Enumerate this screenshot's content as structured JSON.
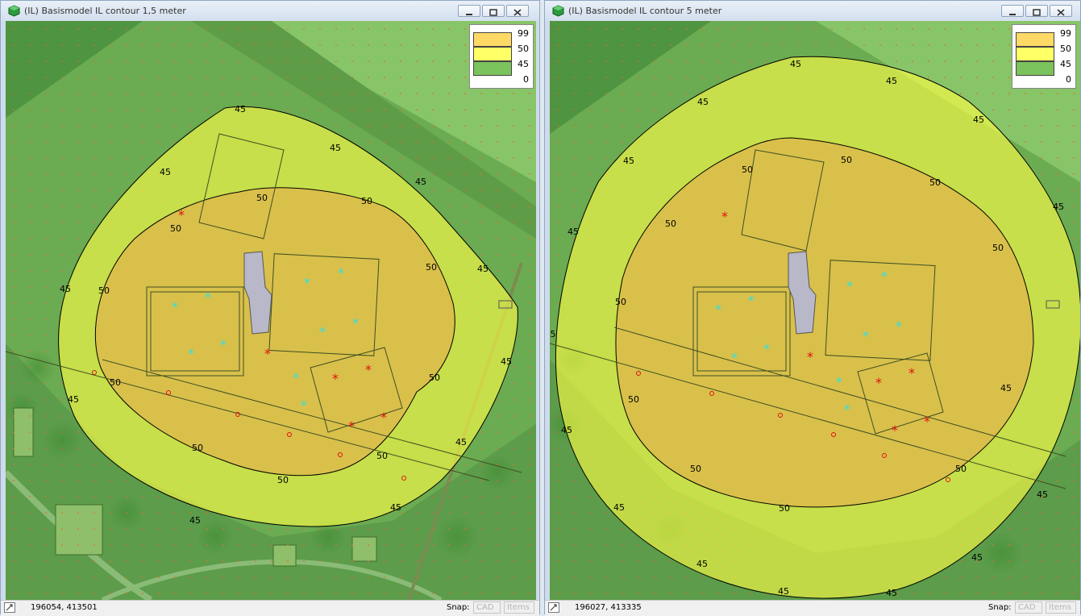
{
  "windows": [
    {
      "title": "(IL) Basismodel IL contour 1,5 meter",
      "legend": [
        "99",
        "50",
        "45",
        "0"
      ],
      "contour_labels": {
        "c45": "45",
        "c50": "50"
      },
      "status": {
        "coords": "196054, 413501",
        "snap_label": "Snap:",
        "cad_label": "CAD",
        "items_label": "Items"
      }
    },
    {
      "title": "(IL) Basismodel IL contour 5 meter",
      "legend": [
        "99",
        "50",
        "45",
        "0"
      ],
      "contour_labels": {
        "c45": "45",
        "c50": "50",
        "edge": "5"
      },
      "status": {
        "coords": "196027, 413335",
        "snap_label": "Snap:",
        "cad_label": "CAD",
        "items_label": "Items"
      }
    }
  ],
  "legend_colors": [
    "#ffd966",
    "#ffff66",
    "#7bc35c"
  ],
  "colors": {
    "map_base": "#6bab52",
    "zone45": "#ffff45",
    "zone50": "#e9a64c",
    "source_red": "#e01010",
    "source_cyan": "#33e0e0"
  }
}
